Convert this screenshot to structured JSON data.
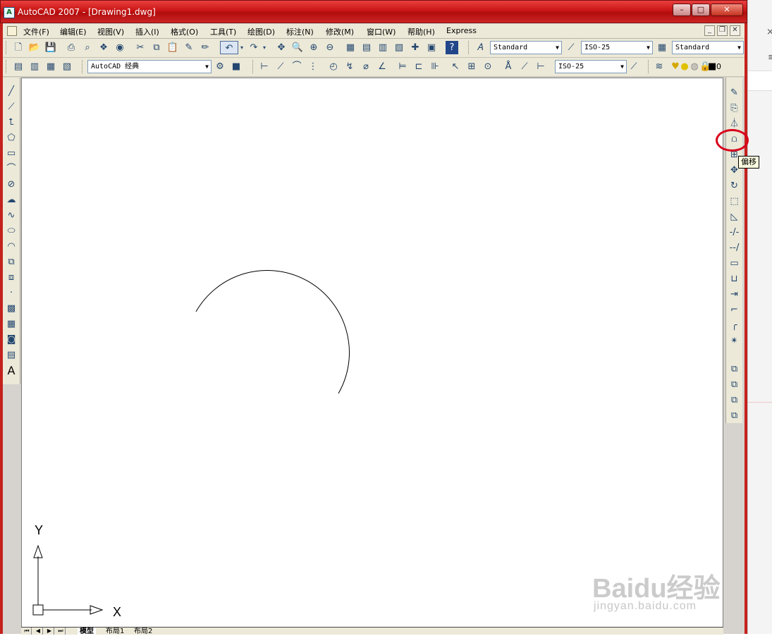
{
  "window": {
    "title": "AutoCAD 2007 - [Drawing1.dwg]",
    "app_icon_glyph": "A",
    "min_glyph": "–",
    "max_glyph": "□",
    "close_glyph": "✕"
  },
  "menu": {
    "items": [
      "文件(F)",
      "编辑(E)",
      "视图(V)",
      "插入(I)",
      "格式(O)",
      "工具(T)",
      "绘图(D)",
      "标注(N)",
      "修改(M)",
      "窗口(W)",
      "帮助(H)",
      "Express"
    ],
    "mdi_min": "_",
    "mdi_restore": "❐",
    "mdi_close": "✕"
  },
  "toolbar": {
    "text_style": "Standard",
    "dim_style": "ISO-25",
    "table_style": "Standard",
    "workspace": "AutoCAD 经典",
    "dim_style2": "ISO-25",
    "layer": "0"
  },
  "tooltip": {
    "label": "偏移"
  },
  "tabs": {
    "model": "模型",
    "layout1": "布局1",
    "layout2": "布局2"
  },
  "ucs": {
    "x_label": "X",
    "y_label": "Y"
  },
  "watermark": {
    "brand": "Baidu经验",
    "url": "jingyan.baidu.com"
  },
  "icons": {
    "left": [
      "line-icon",
      "construction-line-icon",
      "polyline-icon",
      "polygon-icon",
      "rectangle-icon",
      "arc-icon",
      "circle-icon",
      "revision-cloud-icon",
      "spline-icon",
      "ellipse-icon",
      "ellipse-arc-icon",
      "insert-block-icon",
      "make-block-icon",
      "point-icon",
      "hatch-icon",
      "gradient-icon",
      "region-icon",
      "table-icon",
      "multiline-text-icon"
    ],
    "right": [
      "erase-icon",
      "copy-icon",
      "mirror-icon",
      "offset-icon",
      "array-icon",
      "move-icon",
      "rotate-icon",
      "scale-icon",
      "stretch-icon",
      "trim-icon",
      "extend-icon",
      "break-at-point-icon",
      "break-icon",
      "join-icon",
      "chamfer-icon",
      "fillet-icon",
      "explode-icon",
      "draworder-front-icon",
      "draworder-back-icon",
      "draworder-above-icon",
      "draworder-under-icon"
    ]
  }
}
